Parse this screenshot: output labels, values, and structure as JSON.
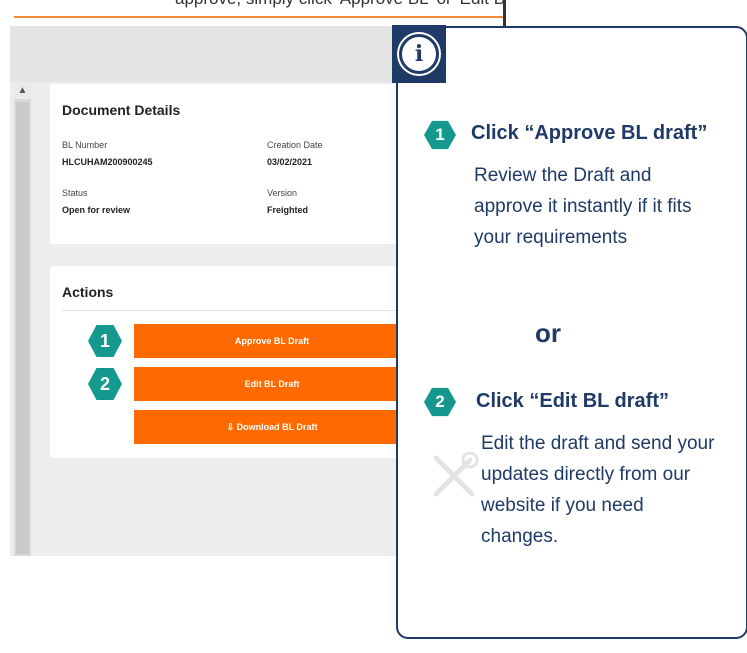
{
  "top": {
    "clipped_text": "approve, simply click 'Approve BL' or 'Edit BL' and update your BL data; "
  },
  "document_details": {
    "title": "Document Details",
    "bl_number_label": "BL Number",
    "bl_number_value": "HLCUHAM200900245",
    "creation_date_label": "Creation Date",
    "creation_date_value": "03/02/2021",
    "status_label": "Status",
    "status_value": "Open for review",
    "version_label": "Version",
    "version_value": "Freighted"
  },
  "actions": {
    "title": "Actions",
    "approve_label": "Approve BL Draft",
    "edit_label": "Edit BL Draft",
    "download_label": "⇩  Download BL Draft"
  },
  "markers": {
    "one": "1",
    "two": "2"
  },
  "info": {
    "icon_glyph": "i",
    "step1_number": "1",
    "step1_title": "Click “Approve BL draft”",
    "step1_text": "Review the Draft and approve it instantly if it fits your requirements",
    "or": "or",
    "step2_number": "2",
    "step2_title": "Click “Edit BL draft”",
    "step2_text": "Edit the draft and send your updates directly from our website if you need changes."
  },
  "colors": {
    "accent_orange": "#ff6a00",
    "teal": "#15998f",
    "navy": "#1f3a66"
  }
}
